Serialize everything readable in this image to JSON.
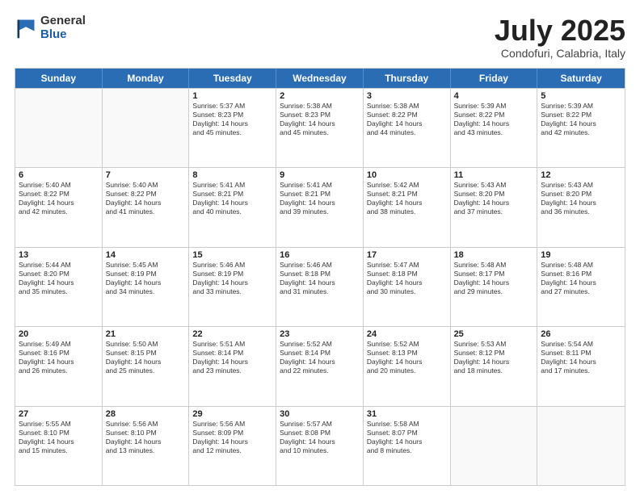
{
  "logo": {
    "general": "General",
    "blue": "Blue"
  },
  "title": "July 2025",
  "subtitle": "Condofuri, Calabria, Italy",
  "header_days": [
    "Sunday",
    "Monday",
    "Tuesday",
    "Wednesday",
    "Thursday",
    "Friday",
    "Saturday"
  ],
  "weeks": [
    [
      {
        "day": "",
        "lines": []
      },
      {
        "day": "",
        "lines": []
      },
      {
        "day": "1",
        "lines": [
          "Sunrise: 5:37 AM",
          "Sunset: 8:23 PM",
          "Daylight: 14 hours",
          "and 45 minutes."
        ]
      },
      {
        "day": "2",
        "lines": [
          "Sunrise: 5:38 AM",
          "Sunset: 8:23 PM",
          "Daylight: 14 hours",
          "and 45 minutes."
        ]
      },
      {
        "day": "3",
        "lines": [
          "Sunrise: 5:38 AM",
          "Sunset: 8:22 PM",
          "Daylight: 14 hours",
          "and 44 minutes."
        ]
      },
      {
        "day": "4",
        "lines": [
          "Sunrise: 5:39 AM",
          "Sunset: 8:22 PM",
          "Daylight: 14 hours",
          "and 43 minutes."
        ]
      },
      {
        "day": "5",
        "lines": [
          "Sunrise: 5:39 AM",
          "Sunset: 8:22 PM",
          "Daylight: 14 hours",
          "and 42 minutes."
        ]
      }
    ],
    [
      {
        "day": "6",
        "lines": [
          "Sunrise: 5:40 AM",
          "Sunset: 8:22 PM",
          "Daylight: 14 hours",
          "and 42 minutes."
        ]
      },
      {
        "day": "7",
        "lines": [
          "Sunrise: 5:40 AM",
          "Sunset: 8:22 PM",
          "Daylight: 14 hours",
          "and 41 minutes."
        ]
      },
      {
        "day": "8",
        "lines": [
          "Sunrise: 5:41 AM",
          "Sunset: 8:21 PM",
          "Daylight: 14 hours",
          "and 40 minutes."
        ]
      },
      {
        "day": "9",
        "lines": [
          "Sunrise: 5:41 AM",
          "Sunset: 8:21 PM",
          "Daylight: 14 hours",
          "and 39 minutes."
        ]
      },
      {
        "day": "10",
        "lines": [
          "Sunrise: 5:42 AM",
          "Sunset: 8:21 PM",
          "Daylight: 14 hours",
          "and 38 minutes."
        ]
      },
      {
        "day": "11",
        "lines": [
          "Sunrise: 5:43 AM",
          "Sunset: 8:20 PM",
          "Daylight: 14 hours",
          "and 37 minutes."
        ]
      },
      {
        "day": "12",
        "lines": [
          "Sunrise: 5:43 AM",
          "Sunset: 8:20 PM",
          "Daylight: 14 hours",
          "and 36 minutes."
        ]
      }
    ],
    [
      {
        "day": "13",
        "lines": [
          "Sunrise: 5:44 AM",
          "Sunset: 8:20 PM",
          "Daylight: 14 hours",
          "and 35 minutes."
        ]
      },
      {
        "day": "14",
        "lines": [
          "Sunrise: 5:45 AM",
          "Sunset: 8:19 PM",
          "Daylight: 14 hours",
          "and 34 minutes."
        ]
      },
      {
        "day": "15",
        "lines": [
          "Sunrise: 5:46 AM",
          "Sunset: 8:19 PM",
          "Daylight: 14 hours",
          "and 33 minutes."
        ]
      },
      {
        "day": "16",
        "lines": [
          "Sunrise: 5:46 AM",
          "Sunset: 8:18 PM",
          "Daylight: 14 hours",
          "and 31 minutes."
        ]
      },
      {
        "day": "17",
        "lines": [
          "Sunrise: 5:47 AM",
          "Sunset: 8:18 PM",
          "Daylight: 14 hours",
          "and 30 minutes."
        ]
      },
      {
        "day": "18",
        "lines": [
          "Sunrise: 5:48 AM",
          "Sunset: 8:17 PM",
          "Daylight: 14 hours",
          "and 29 minutes."
        ]
      },
      {
        "day": "19",
        "lines": [
          "Sunrise: 5:48 AM",
          "Sunset: 8:16 PM",
          "Daylight: 14 hours",
          "and 27 minutes."
        ]
      }
    ],
    [
      {
        "day": "20",
        "lines": [
          "Sunrise: 5:49 AM",
          "Sunset: 8:16 PM",
          "Daylight: 14 hours",
          "and 26 minutes."
        ]
      },
      {
        "day": "21",
        "lines": [
          "Sunrise: 5:50 AM",
          "Sunset: 8:15 PM",
          "Daylight: 14 hours",
          "and 25 minutes."
        ]
      },
      {
        "day": "22",
        "lines": [
          "Sunrise: 5:51 AM",
          "Sunset: 8:14 PM",
          "Daylight: 14 hours",
          "and 23 minutes."
        ]
      },
      {
        "day": "23",
        "lines": [
          "Sunrise: 5:52 AM",
          "Sunset: 8:14 PM",
          "Daylight: 14 hours",
          "and 22 minutes."
        ]
      },
      {
        "day": "24",
        "lines": [
          "Sunrise: 5:52 AM",
          "Sunset: 8:13 PM",
          "Daylight: 14 hours",
          "and 20 minutes."
        ]
      },
      {
        "day": "25",
        "lines": [
          "Sunrise: 5:53 AM",
          "Sunset: 8:12 PM",
          "Daylight: 14 hours",
          "and 18 minutes."
        ]
      },
      {
        "day": "26",
        "lines": [
          "Sunrise: 5:54 AM",
          "Sunset: 8:11 PM",
          "Daylight: 14 hours",
          "and 17 minutes."
        ]
      }
    ],
    [
      {
        "day": "27",
        "lines": [
          "Sunrise: 5:55 AM",
          "Sunset: 8:10 PM",
          "Daylight: 14 hours",
          "and 15 minutes."
        ]
      },
      {
        "day": "28",
        "lines": [
          "Sunrise: 5:56 AM",
          "Sunset: 8:10 PM",
          "Daylight: 14 hours",
          "and 13 minutes."
        ]
      },
      {
        "day": "29",
        "lines": [
          "Sunrise: 5:56 AM",
          "Sunset: 8:09 PM",
          "Daylight: 14 hours",
          "and 12 minutes."
        ]
      },
      {
        "day": "30",
        "lines": [
          "Sunrise: 5:57 AM",
          "Sunset: 8:08 PM",
          "Daylight: 14 hours",
          "and 10 minutes."
        ]
      },
      {
        "day": "31",
        "lines": [
          "Sunrise: 5:58 AM",
          "Sunset: 8:07 PM",
          "Daylight: 14 hours",
          "and 8 minutes."
        ]
      },
      {
        "day": "",
        "lines": []
      },
      {
        "day": "",
        "lines": []
      }
    ]
  ]
}
